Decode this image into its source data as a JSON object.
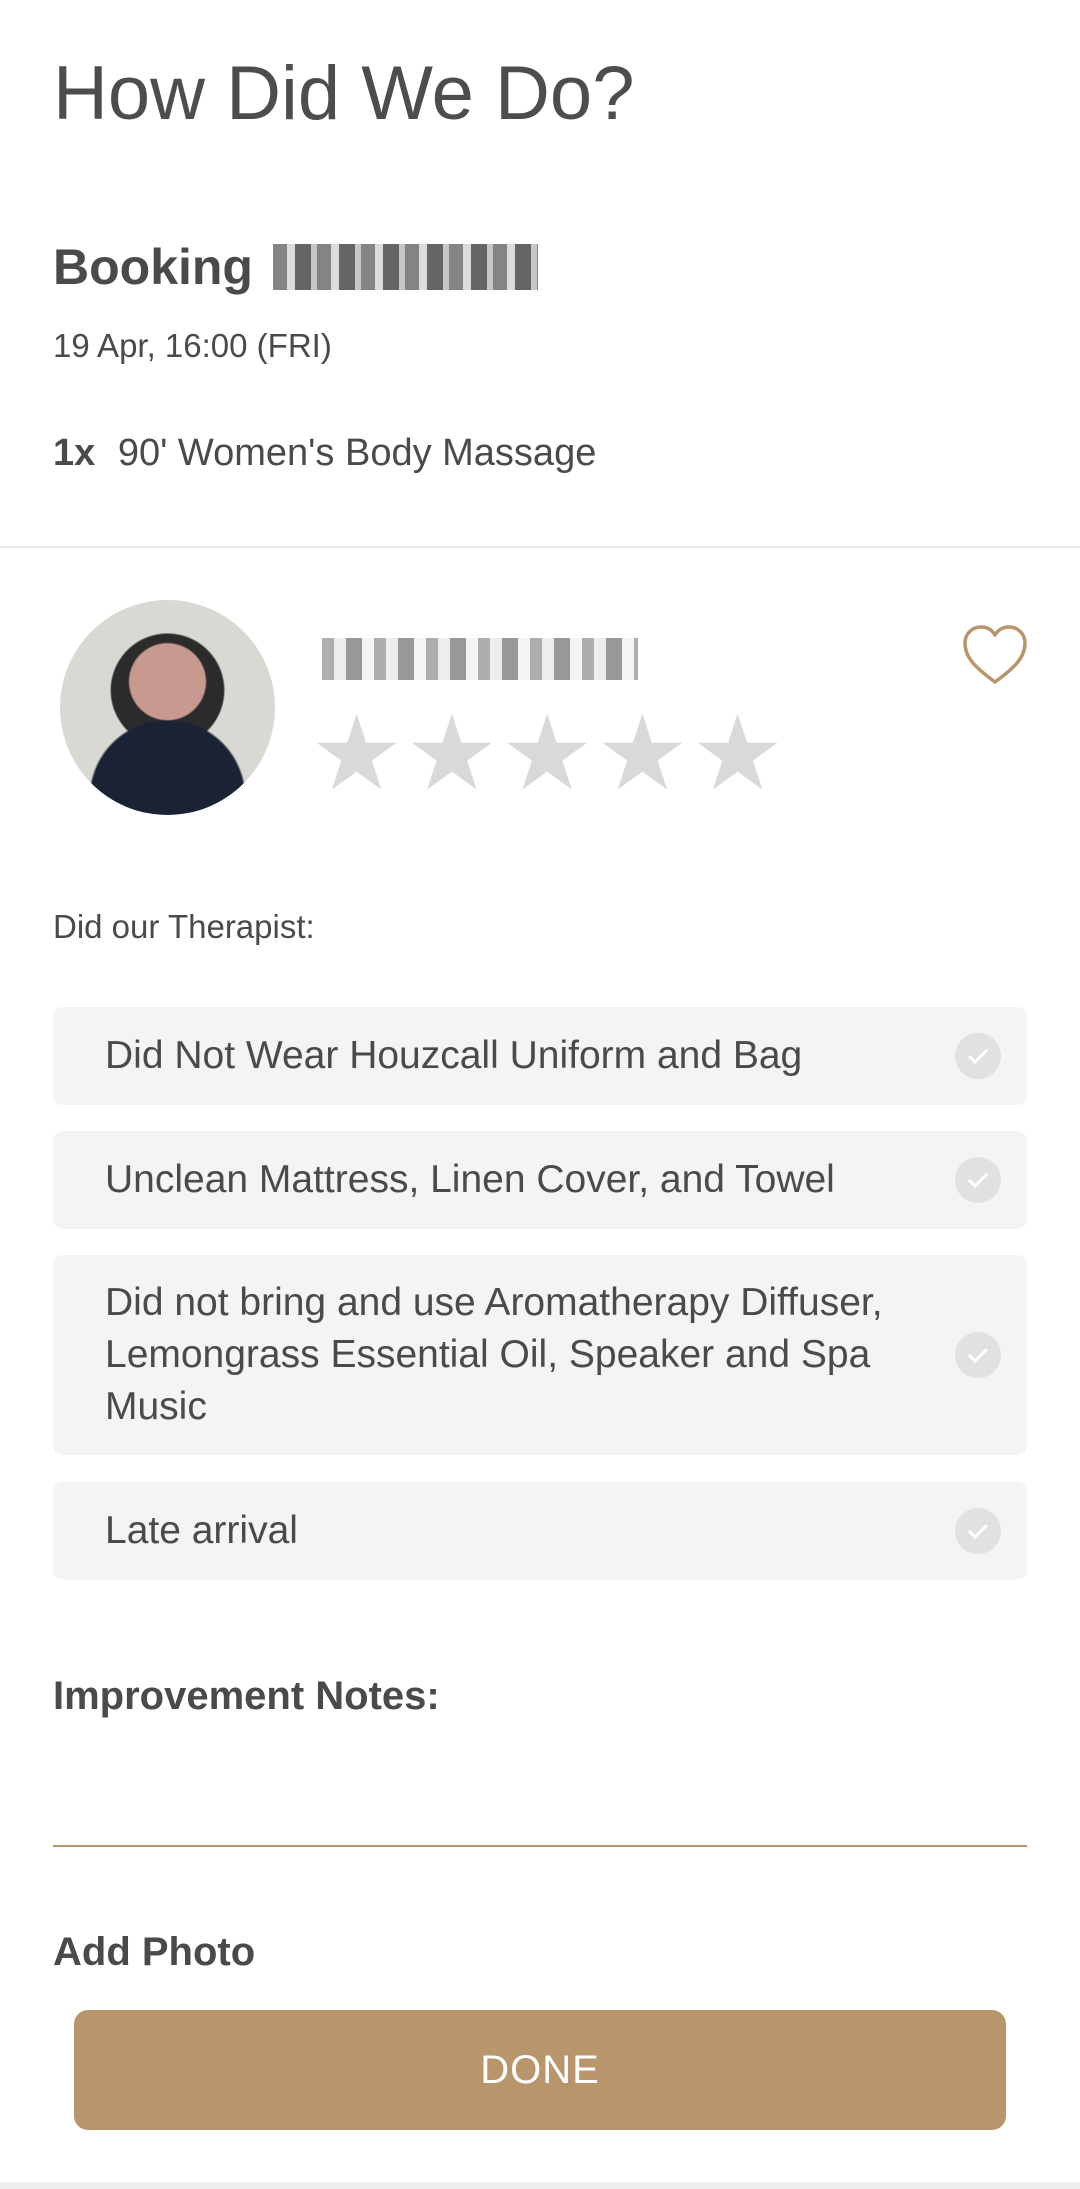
{
  "page": {
    "title": "How Did We Do?"
  },
  "booking": {
    "label": "Booking",
    "date": "19 Apr, 16:00 (FRI)",
    "service_qty": "1x",
    "service_name": "90' Women's Body Massage"
  },
  "therapist": {
    "rating_max": 5,
    "favorite_icon": "heart-outline-icon"
  },
  "feedback": {
    "question": "Did our Therapist:",
    "options": [
      {
        "label": "Did Not Wear Houzcall Uniform and Bag",
        "checked": false
      },
      {
        "label": "Unclean Mattress, Linen Cover, and Towel",
        "checked": false
      },
      {
        "label": "Did not bring and use Aromatherapy Diffuser, Lemongrass Essential Oil, Speaker and Spa Music",
        "checked": false
      },
      {
        "label": "Late arrival",
        "checked": false
      }
    ]
  },
  "notes": {
    "label": "Improvement Notes:",
    "value": ""
  },
  "photo": {
    "label": "Add Photo"
  },
  "actions": {
    "done_label": "DONE"
  },
  "colors": {
    "accent": "#b8956a",
    "option_bg": "#f5f4f2",
    "text": "#4a4a4a"
  }
}
